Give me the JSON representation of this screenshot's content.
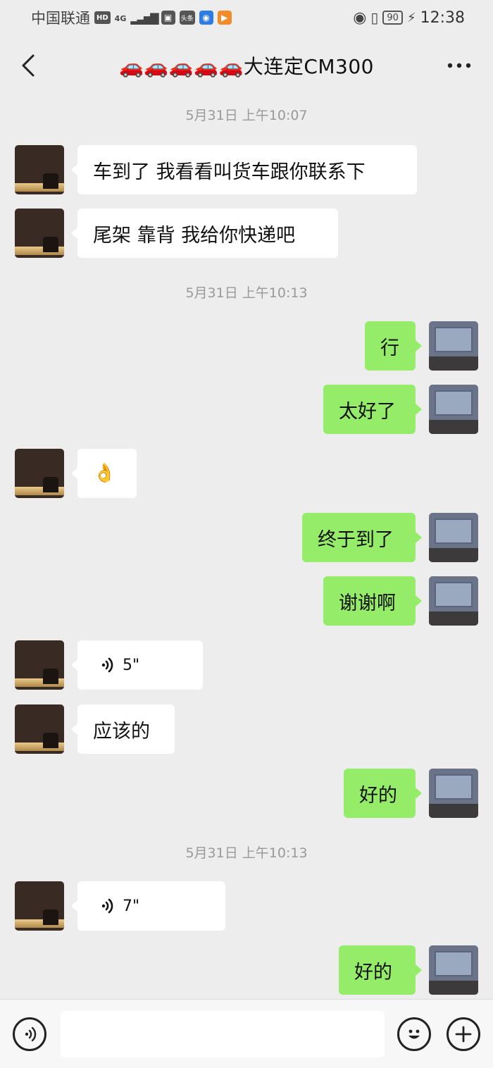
{
  "status_bar": {
    "carrier": "中国联通",
    "hd_badge": "HD",
    "network": "4G",
    "app_toutiao": "头条",
    "battery": "90",
    "time": "12:38"
  },
  "header": {
    "title": "🚗🚗🚗🚗🚗大连定CM300"
  },
  "messages": [
    {
      "kind": "time",
      "text": "5月31日 上午10:07"
    },
    {
      "kind": "msg",
      "side": "left",
      "text": "车到了 我看看叫货车跟你联系下"
    },
    {
      "kind": "msg",
      "side": "left",
      "text": "尾架 靠背  我给你快递吧"
    },
    {
      "kind": "time",
      "text": "5月31日 上午10:13"
    },
    {
      "kind": "msg",
      "side": "right",
      "text": "行"
    },
    {
      "kind": "msg",
      "side": "right",
      "text": "太好了"
    },
    {
      "kind": "msg",
      "side": "left",
      "text": "👌"
    },
    {
      "kind": "msg",
      "side": "right",
      "text": "终于到了"
    },
    {
      "kind": "msg",
      "side": "right",
      "text": "谢谢啊"
    },
    {
      "kind": "voice",
      "side": "left",
      "duration": "5\""
    },
    {
      "kind": "msg",
      "side": "left",
      "text": "应该的"
    },
    {
      "kind": "msg",
      "side": "right",
      "text": "好的"
    },
    {
      "kind": "time",
      "text": "5月31日 上午10:13"
    },
    {
      "kind": "voice",
      "side": "left",
      "duration": "7\""
    },
    {
      "kind": "msg",
      "side": "right",
      "text": "好的"
    }
  ],
  "input_bar": {
    "text_value": "",
    "icons": [
      "voice-icon",
      "emoji-icon",
      "plus-icon"
    ]
  },
  "colors": {
    "background": "#ededed",
    "own_bubble": "#95ec69",
    "other_bubble": "#ffffff"
  }
}
